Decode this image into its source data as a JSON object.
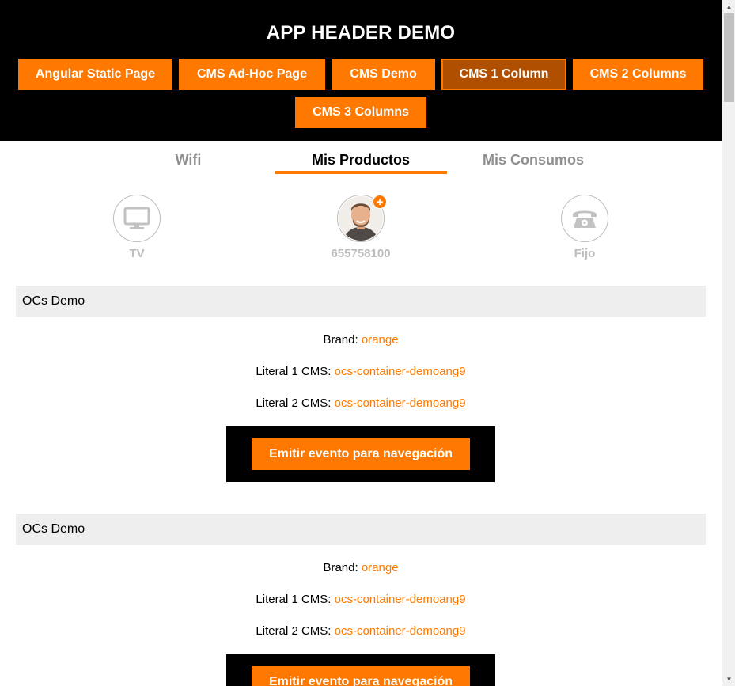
{
  "header": {
    "title": "APP HEADER DEMO",
    "nav": [
      {
        "label": "Angular Static Page",
        "active": false
      },
      {
        "label": "CMS Ad-Hoc Page",
        "active": false
      },
      {
        "label": "CMS Demo",
        "active": false
      },
      {
        "label": "CMS 1 Column",
        "active": true
      },
      {
        "label": "CMS 2 Columns",
        "active": false
      },
      {
        "label": "CMS 3 Columns",
        "active": false
      }
    ]
  },
  "tabs": [
    {
      "label": "Wifi",
      "active": false
    },
    {
      "label": "Mis Productos",
      "active": true
    },
    {
      "label": "Mis Consumos",
      "active": false
    }
  ],
  "products": [
    {
      "label": "TV",
      "icon": "tv-icon"
    },
    {
      "label": "655758100",
      "icon": "avatar",
      "badge": "+"
    },
    {
      "label": "Fijo",
      "icon": "landline-phone-icon"
    }
  ],
  "sections": [
    {
      "title": "OCs Demo",
      "brand_label": "Brand: ",
      "brand_value": "orange",
      "literal1_label": "Literal 1 CMS: ",
      "literal1_value": "ocs-container-demoang9",
      "literal2_label": "Literal 2 CMS: ",
      "literal2_value": "ocs-container-demoang9",
      "button_label": "Emitir evento para navegación"
    },
    {
      "title": "OCs Demo",
      "brand_label": "Brand: ",
      "brand_value": "orange",
      "literal1_label": "Literal 1 CMS: ",
      "literal1_value": "ocs-container-demoang9",
      "literal2_label": "Literal 2 CMS: ",
      "literal2_value": "ocs-container-demoang9",
      "button_label": "Emitir evento para navegación"
    }
  ],
  "colors": {
    "accent": "#ff7900",
    "active_nav": "#b04f00",
    "header_bg": "#000000",
    "section_header_bg": "#eeeeee",
    "muted": "#bdbdbd"
  }
}
